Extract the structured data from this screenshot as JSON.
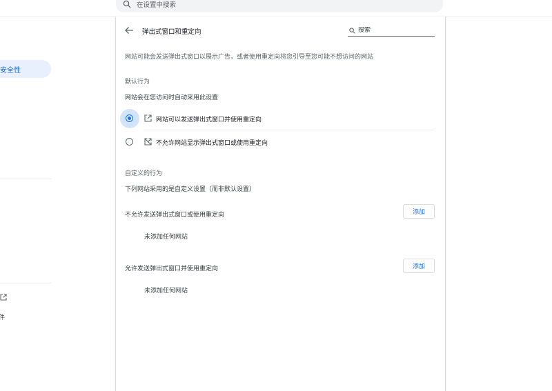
{
  "top_search": {
    "placeholder": "在设置中搜索"
  },
  "sidebar": {
    "active_item_fragment": "安全性",
    "fragment_text": "件"
  },
  "header": {
    "title": "弹出式窗口和重定向",
    "search_placeholder": "搜索"
  },
  "description": "网站可能会发送弹出式窗口以展示广告，或者使用重定向将您引导至您可能不想访问的网站",
  "default_behavior": {
    "title": "默认行为",
    "subtitle": "网站会在您访问时自动采用此设置",
    "options": [
      {
        "label": "网站可以发送弹出式窗口并使用重定向",
        "selected": true,
        "icon": "open-in-new-icon"
      },
      {
        "label": "不允许网站显示弹出式窗口或使用重定向",
        "selected": false,
        "icon": "popup-blocked-icon"
      }
    ]
  },
  "custom_behavior": {
    "title": "自定义的行为",
    "subtitle": "下列网站采用的是自定义设置（而非默认设置）",
    "blocked": {
      "label": "不允许发送弹出式窗口或使用重定向",
      "add_label": "添加",
      "empty_text": "未添加任何网站"
    },
    "allowed": {
      "label": "允许发送弹出式窗口并使用重定向",
      "add_label": "添加",
      "empty_text": "未添加任何网站"
    }
  },
  "colors": {
    "accent": "#1a73e8",
    "active_nav_bg": "#e8f0fe",
    "selected_halo": "#d2e3fc"
  }
}
